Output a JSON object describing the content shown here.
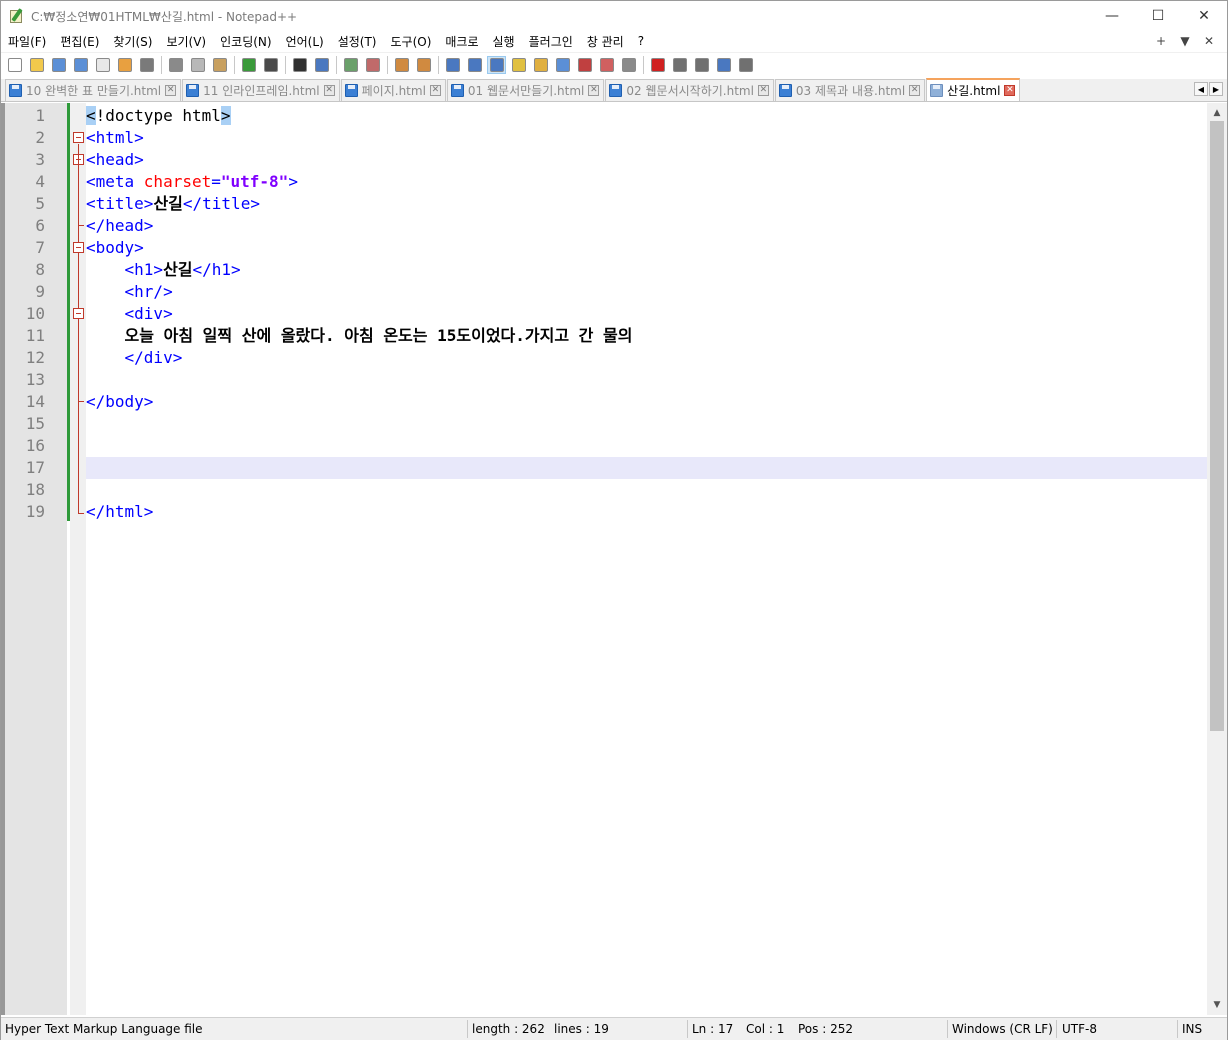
{
  "window": {
    "title": "C:₩정소연₩01HTML₩산길.html - Notepad++",
    "minimize": "—",
    "maximize": "☐",
    "close": "✕"
  },
  "menu": {
    "items": [
      "파일(F)",
      "편집(E)",
      "찾기(S)",
      "보기(V)",
      "인코딩(N)",
      "언어(L)",
      "설정(T)",
      "도구(O)",
      "매크로",
      "실행",
      "플러그인",
      "창 관리",
      "?"
    ],
    "right": [
      "+",
      "▼",
      "✕"
    ]
  },
  "toolbar": {
    "icons": [
      {
        "name": "new-file-icon",
        "color": "#ffffff"
      },
      {
        "name": "open-file-icon",
        "color": "#f2c94c"
      },
      {
        "name": "save-icon",
        "color": "#5b8fd6"
      },
      {
        "name": "save-all-icon",
        "color": "#5b8fd6"
      },
      {
        "name": "close-file-icon",
        "color": "#e8e8e8"
      },
      {
        "name": "close-all-icon",
        "color": "#e8a040"
      },
      {
        "name": "print-icon",
        "color": "#7a7a7a"
      },
      {
        "name": "cut-icon",
        "color": "#8a8a8a"
      },
      {
        "name": "copy-icon",
        "color": "#b8b8b8"
      },
      {
        "name": "paste-icon",
        "color": "#c8a060"
      },
      {
        "name": "undo-icon",
        "color": "#3a9a3a"
      },
      {
        "name": "redo-icon",
        "color": "#4a4a4a"
      },
      {
        "name": "find-icon",
        "color": "#303030"
      },
      {
        "name": "replace-icon",
        "color": "#4a78c0"
      },
      {
        "name": "zoom-in-icon",
        "color": "#6aa06a"
      },
      {
        "name": "zoom-out-icon",
        "color": "#c06a6a"
      },
      {
        "name": "sync-vertical-icon",
        "color": "#d08a40"
      },
      {
        "name": "sync-horizontal-icon",
        "color": "#d08a40"
      },
      {
        "name": "word-wrap-icon",
        "color": "#4a78c0"
      },
      {
        "name": "show-all-chars-icon",
        "color": "#4a78c0"
      },
      {
        "name": "indent-guide-icon",
        "color": "#4a78c0"
      },
      {
        "name": "doc-map-icon",
        "color": "#e0c040"
      },
      {
        "name": "function-list-icon",
        "color": "#e0b040"
      },
      {
        "name": "folder-as-workspace-icon",
        "color": "#5b8fd6"
      },
      {
        "name": "doc-list-icon",
        "color": "#c04040"
      },
      {
        "name": "monitoring-icon",
        "color": "#d06060"
      },
      {
        "name": "view-icon",
        "color": "#8a8a8a"
      },
      {
        "name": "record-macro-icon",
        "color": "#d02020"
      },
      {
        "name": "stop-macro-icon",
        "color": "#707070"
      },
      {
        "name": "play-macro-icon",
        "color": "#707070"
      },
      {
        "name": "run-macro-multiple-icon",
        "color": "#4a78c0"
      },
      {
        "name": "save-macro-icon",
        "color": "#707070"
      }
    ]
  },
  "tabs": [
    {
      "label": "10 완벽한 표 만들기.html",
      "active": false
    },
    {
      "label": "11 인라인프레임.html",
      "active": false
    },
    {
      "label": "페이지.html",
      "active": false
    },
    {
      "label": "01 웹문서만들기.html",
      "active": false
    },
    {
      "label": "02 웹문서시작하기.html",
      "active": false
    },
    {
      "label": "03 제목과 내용.html",
      "active": false
    },
    {
      "label": "산길.html",
      "active": true
    }
  ],
  "editor": {
    "line_numbers": [
      "1",
      "2",
      "3",
      "4",
      "5",
      "6",
      "7",
      "8",
      "9",
      "10",
      "11",
      "12",
      "13",
      "14",
      "15",
      "16",
      "17",
      "18",
      "19"
    ],
    "l1": {
      "a": "<",
      "b": "!doctype html",
      "c": ">"
    },
    "l2": "<html>",
    "l3": "<head>",
    "l4": {
      "open": "<meta ",
      "attr": "charset",
      "eq": "=",
      "val": "\"utf-8\"",
      "close": ">"
    },
    "l5": {
      "open": "<title>",
      "text": "산길",
      "close": "</title>"
    },
    "l6": "</head>",
    "l7": "<body>",
    "l8": {
      "indent": "    ",
      "open": "<h1>",
      "text": "산길",
      "close": "</h1>"
    },
    "l9": {
      "indent": "    ",
      "tag": "<hr/>"
    },
    "l10": {
      "indent": "    ",
      "tag": "<div>"
    },
    "l11": {
      "indent": "    ",
      "text": "오늘 아침 일찍 산에 올랐다. 아침 온도는 15도이었다.가지고 간 물의"
    },
    "l12": {
      "indent": "    ",
      "tag": "</div>"
    },
    "l14": "</body>",
    "l19": "</html>"
  },
  "status": {
    "file_type": "Hyper Text Markup Language file",
    "length": "length : 262",
    "lines": "lines : 19",
    "ln": "Ln : 17",
    "col": "Col : 1",
    "pos": "Pos : 252",
    "eol": "Windows (CR LF)",
    "encoding": "UTF-8",
    "mode": "INS"
  },
  "colors": {
    "tag": "#0000ff",
    "attr": "#ff0000",
    "value": "#8000ff",
    "active_tab_accent": "#f5a35d",
    "change_bar": "#2e9a3a",
    "caret_line": "#e8e8fa"
  }
}
